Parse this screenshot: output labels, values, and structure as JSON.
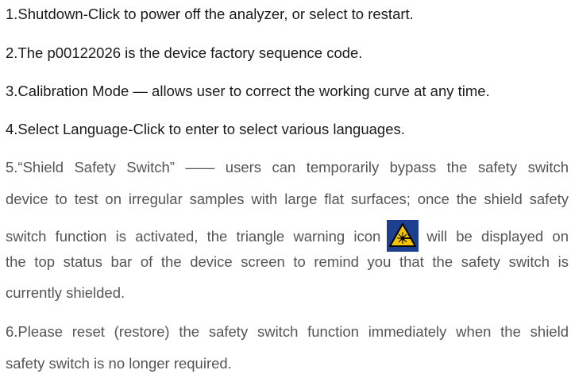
{
  "items": [
    "1.Shutdown-Click to power off the analyzer, or select to restart.",
    "2.The p00122026 is the device factory sequence code.",
    "3.Calibration Mode — allows user to correct the working curve at any time.",
    "4.Select Language-Click to enter to select various languages."
  ],
  "item5": {
    "line1": "5.“Shield Safety Switch” —— users can temporarily bypass the safety switch",
    "line2": "device to test on irregular samples with large flat surfaces; once the shield safety",
    "line3_before": "switch function is activated, the triangle warning icon",
    "line3_after": "will be displayed on",
    "line4": "the top status bar of the device screen to remind you that the safety switch is",
    "line5": "currently shielded.",
    "icon": "laser-warning-icon"
  },
  "item6": {
    "line1": "6.Please reset (restore) the safety switch function immediately when the shield",
    "line2": "safety switch is no longer required."
  },
  "colors": {
    "icon_bg": "#1d3f8f",
    "icon_triangle": "#f5c400"
  }
}
